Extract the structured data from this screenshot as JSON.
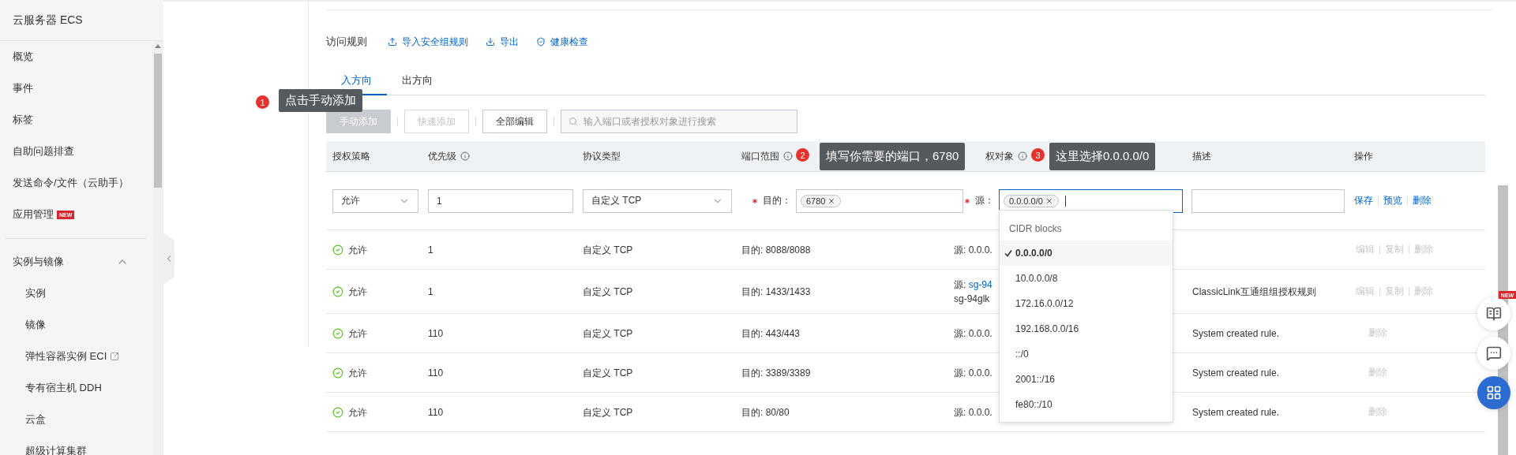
{
  "sidebar": {
    "title": "云服务器 ECS",
    "items": [
      {
        "label": "概览"
      },
      {
        "label": "事件"
      },
      {
        "label": "标签"
      },
      {
        "label": "自助问题排查"
      },
      {
        "label": "发送命令/文件（云助手）"
      },
      {
        "label": "应用管理",
        "badge": "NEW"
      }
    ],
    "group": {
      "label": "实例与镜像",
      "expanded": true,
      "children": [
        {
          "label": "实例"
        },
        {
          "label": "镜像"
        },
        {
          "label": "弹性容器实例 ECI",
          "external": true
        },
        {
          "label": "专有宿主机 DDH",
          "external": false
        },
        {
          "label": "云盒"
        },
        {
          "label": "超级计算集群"
        }
      ]
    }
  },
  "section": {
    "title": "访问规则",
    "actions": [
      {
        "label": "导入安全组规则"
      },
      {
        "label": "导出"
      },
      {
        "label": "健康检查"
      }
    ]
  },
  "tabs": [
    {
      "label": "入方向",
      "selected": true
    },
    {
      "label": "出方向",
      "selected": false
    }
  ],
  "toolbar": {
    "buttons": [
      {
        "label": "手动添加",
        "kind": "primary",
        "disabled": true
      },
      {
        "label": "快速添加",
        "kind": "outline",
        "disabled": true
      },
      {
        "label": "全部编辑",
        "kind": "outline",
        "disabled": false
      }
    ],
    "search": {
      "placeholder": "输入端口或者授权对象进行搜索"
    }
  },
  "table": {
    "columns": [
      {
        "label": "授权策略",
        "info": false
      },
      {
        "label": "优先级",
        "info": true
      },
      {
        "label": "协议类型",
        "info": false
      },
      {
        "label": "端口范围",
        "info": true
      },
      {
        "label": "权对象",
        "info": true
      },
      {
        "label": "描述",
        "info": false
      },
      {
        "label": "操作",
        "info": false
      }
    ],
    "edit_row": {
      "policy": "允许",
      "priority": "1",
      "protocol": "自定义 TCP",
      "port_label": "目的：",
      "port_required": true,
      "port_tags": [
        "6780"
      ],
      "source_label": "源：",
      "source_required": true,
      "source_tags": [
        "0.0.0.0/0"
      ],
      "actions": [
        "保存",
        "预览",
        "删除"
      ]
    },
    "rows": [
      {
        "policy": "允许",
        "priority": "1",
        "protocol": "自定义 TCP",
        "port": "目的: 8088/8088",
        "source": "源: 0.0.0.",
        "actions": [
          {
            "label": "编辑",
            "disabled": true
          },
          {
            "label": "复制",
            "disabled": true
          },
          {
            "label": "删除",
            "disabled": true
          }
        ]
      },
      {
        "policy": "允许",
        "priority": "1",
        "protocol": "自定义 TCP",
        "port": "目的: 1433/1433",
        "source": "源: ",
        "source_link": "sg-94",
        "source_extra": "sg-94glk",
        "description": "ClassicLink互通组组授权规则",
        "actions": [
          {
            "label": "编辑",
            "disabled": true
          },
          {
            "label": "复制",
            "disabled": true
          },
          {
            "label": "删除",
            "disabled": true
          }
        ]
      },
      {
        "policy": "允许",
        "priority": "110",
        "protocol": "自定义 TCP",
        "port": "目的: 443/443",
        "source": "源: 0.0.0.",
        "description": "System created rule.",
        "actions": [
          {
            "label": "删除",
            "disabled": true
          }
        ]
      },
      {
        "policy": "允许",
        "priority": "110",
        "protocol": "自定义 TCP",
        "port": "目的: 3389/3389",
        "source": "源: 0.0.0.",
        "description": "System created rule.",
        "actions": [
          {
            "label": "删除",
            "disabled": true
          }
        ]
      },
      {
        "policy": "允许",
        "priority": "110",
        "protocol": "自定义 TCP",
        "port": "目的: 80/80",
        "source": "源: 0.0.0.",
        "description": "System created rule.",
        "actions": [
          {
            "label": "删除",
            "disabled": true
          }
        ]
      }
    ]
  },
  "dropdown": {
    "header": "CIDR blocks",
    "options": [
      {
        "label": "0.0.0.0/0",
        "selected": true
      },
      {
        "label": "10.0.0.0/8",
        "selected": false
      },
      {
        "label": "172.16.0.0/12",
        "selected": false
      },
      {
        "label": "192.168.0.0/16",
        "selected": false
      },
      {
        "label": "::/0",
        "selected": false
      },
      {
        "label": "2001::/16",
        "selected": false
      },
      {
        "label": "fe80::/10",
        "selected": false
      }
    ]
  },
  "annotations": [
    {
      "number": "1",
      "text": "点击手动添加"
    },
    {
      "number": "2",
      "text": "填写你需要的端口，6780"
    },
    {
      "number": "3",
      "text": "这里选择0.0.0.0/0"
    }
  ],
  "float_buttons": [
    {
      "badge": "NEW",
      "kind": "plain"
    },
    {
      "kind": "plain"
    },
    {
      "kind": "primary"
    }
  ]
}
